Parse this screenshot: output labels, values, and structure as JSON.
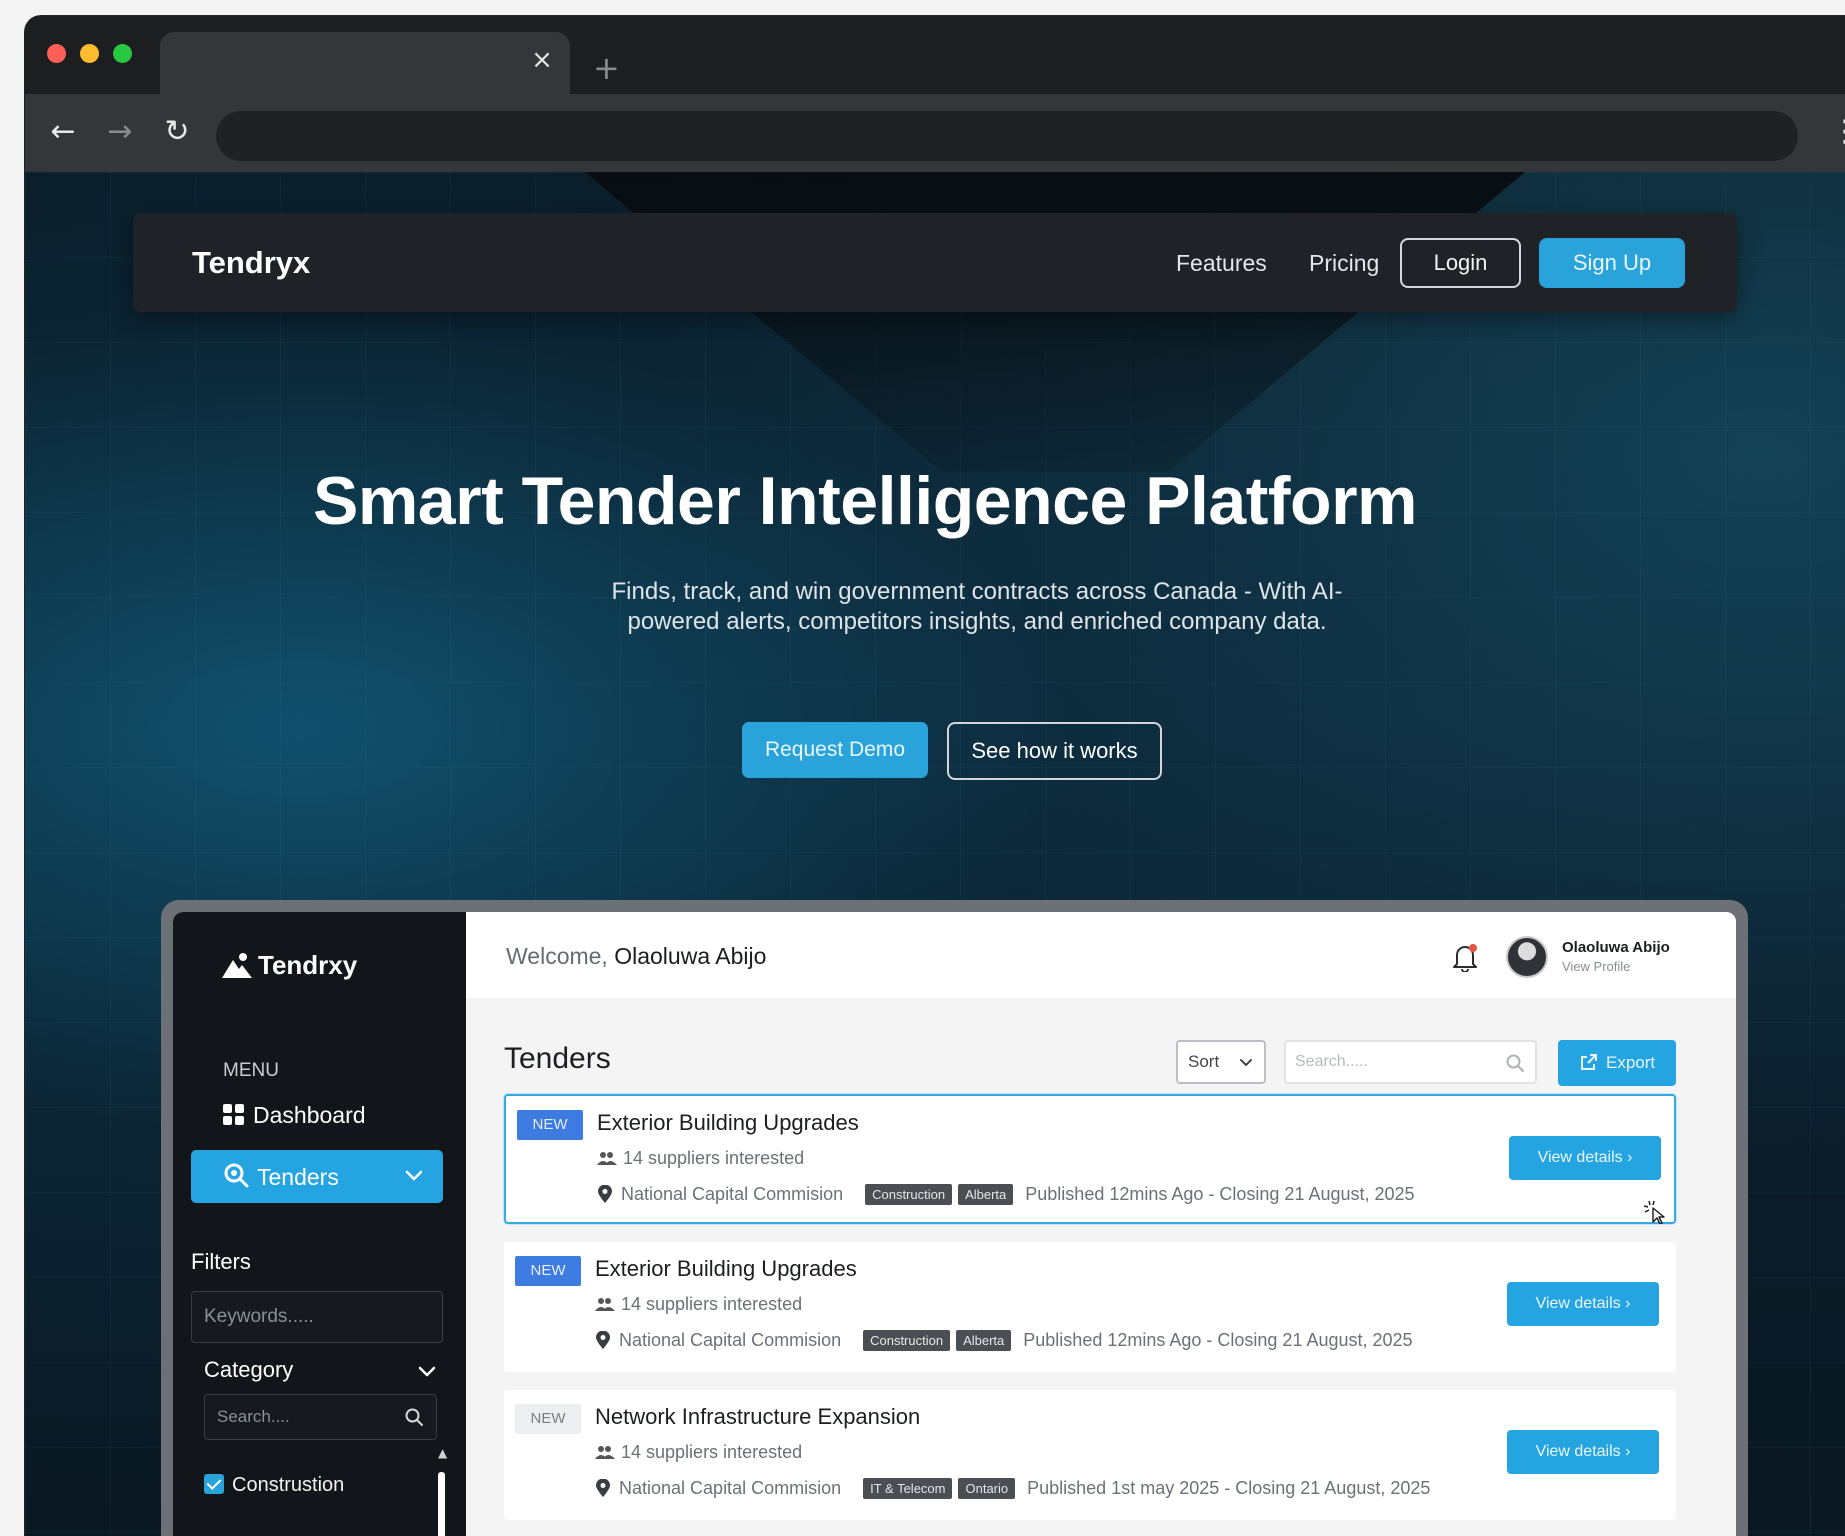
{
  "browser": {
    "tab_close": "×",
    "new_tab": "+",
    "back": "←",
    "forward": "→",
    "reload": "↻",
    "menu": "⋮"
  },
  "site_nav": {
    "brand": "Tendryx",
    "links": [
      "Features",
      "Pricing"
    ],
    "login": "Login",
    "signup": "Sign Up"
  },
  "hero": {
    "title": "Smart Tender Intelligence Platform",
    "subtitle": "Finds, track, and win government contracts across Canada - With AI-powered alerts, competitors insights, and enriched company data.",
    "primary_cta": "Request Demo",
    "secondary_cta": "See how it works"
  },
  "app": {
    "sidebar": {
      "brand": "Tendrxy",
      "menu_label": "MENU",
      "dashboard": "Dashboard",
      "tenders": "Tenders",
      "filters_label": "Filters",
      "keywords_placeholder": "Keywords.....",
      "category_label": "Category",
      "category_search_placeholder": "Search....",
      "categories": [
        {
          "label": "Construstion",
          "checked": true
        }
      ]
    },
    "topbar": {
      "welcome_prefix": "Welcome,",
      "welcome_name": "Olaoluwa Abijo",
      "user_name": "Olaoluwa Abijo",
      "user_link": "View Profile"
    },
    "tenders_heading": "Tenders",
    "sort_label": "Sort",
    "search_placeholder": "Search.....",
    "export_label": "Export",
    "tenders": [
      {
        "badge": "NEW",
        "title": "Exterior Building Upgrades",
        "suppliers": "14 suppliers interested",
        "org": "National Capital Commision",
        "tags": [
          "Construction",
          "Alberta"
        ],
        "published": "Published 12mins Ago - Closing 21 August, 2025",
        "action": "View details ›"
      },
      {
        "badge": "NEW",
        "title": "Exterior Building Upgrades",
        "suppliers": "14 suppliers interested",
        "org": "National Capital Commision",
        "tags": [
          "Construction",
          "Alberta"
        ],
        "published": "Published 12mins Ago - Closing 21 August, 2025",
        "action": "View details ›"
      },
      {
        "badge": "NEW",
        "title": "Network Infrastructure Expansion",
        "suppliers": "14 suppliers interested",
        "org": "National Capital Commision",
        "tags": [
          "IT & Telecom",
          "Ontario"
        ],
        "published": "Published 1st may 2025 - Closing 21 August, 2025",
        "action": "View details ›"
      }
    ]
  },
  "colors": {
    "accent": "#24a4e0",
    "new_badge": "#3e7be0",
    "dark_panel": "#121519"
  }
}
